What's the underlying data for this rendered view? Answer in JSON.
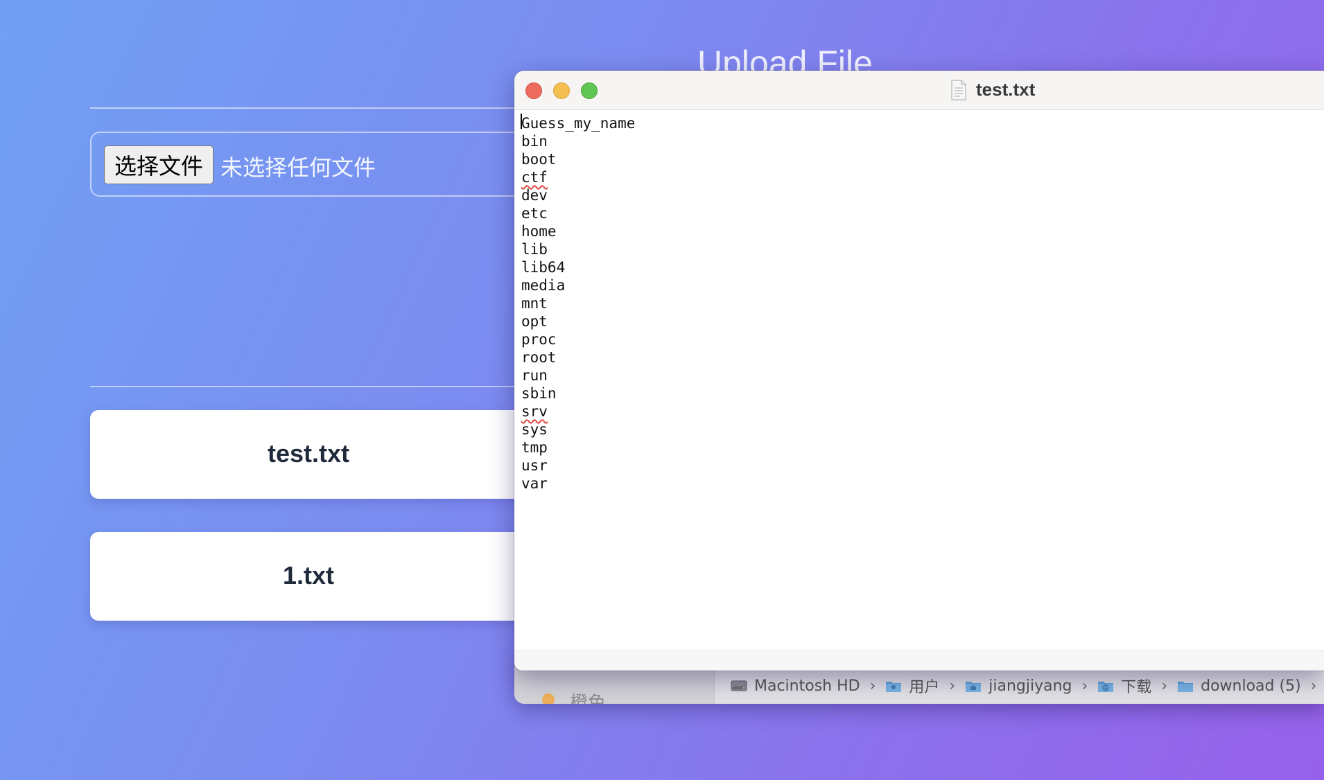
{
  "page": {
    "title": "Upload File",
    "file_button_label": "选择文件",
    "file_status": "未选择任何文件",
    "uploaded_files": [
      {
        "name": "test.txt"
      },
      {
        "name": "1.txt"
      }
    ]
  },
  "finder": {
    "sidebar_tag": {
      "label": "橙色",
      "color": "#f0b25a"
    },
    "path": [
      {
        "label": "Macintosh HD",
        "icon": "hard-drive-icon"
      },
      {
        "label": "用户",
        "icon": "folder-icon"
      },
      {
        "label": "jiangjiyang",
        "icon": "home-folder-icon"
      },
      {
        "label": "下载",
        "icon": "downloads-folder-icon"
      },
      {
        "label": "download (5)",
        "icon": "folder-icon"
      }
    ],
    "separator": "›"
  },
  "textedit": {
    "title": "test.txt",
    "icon": "text-document-icon",
    "lines": [
      "Guess_my_name",
      "bin",
      "boot",
      "ctf",
      "dev",
      "etc",
      "home",
      "lib",
      "lib64",
      "media",
      "mnt",
      "opt",
      "proc",
      "root",
      "run",
      "sbin",
      "srv",
      "sys",
      "tmp",
      "usr",
      "var"
    ],
    "spellcheck_flagged": [
      "ctf",
      "srv"
    ]
  },
  "colors": {
    "close": "#ed6a5e",
    "minimize": "#f5bf4f",
    "maximize": "#61c554",
    "spellcheck_underline": "#e0453d"
  }
}
